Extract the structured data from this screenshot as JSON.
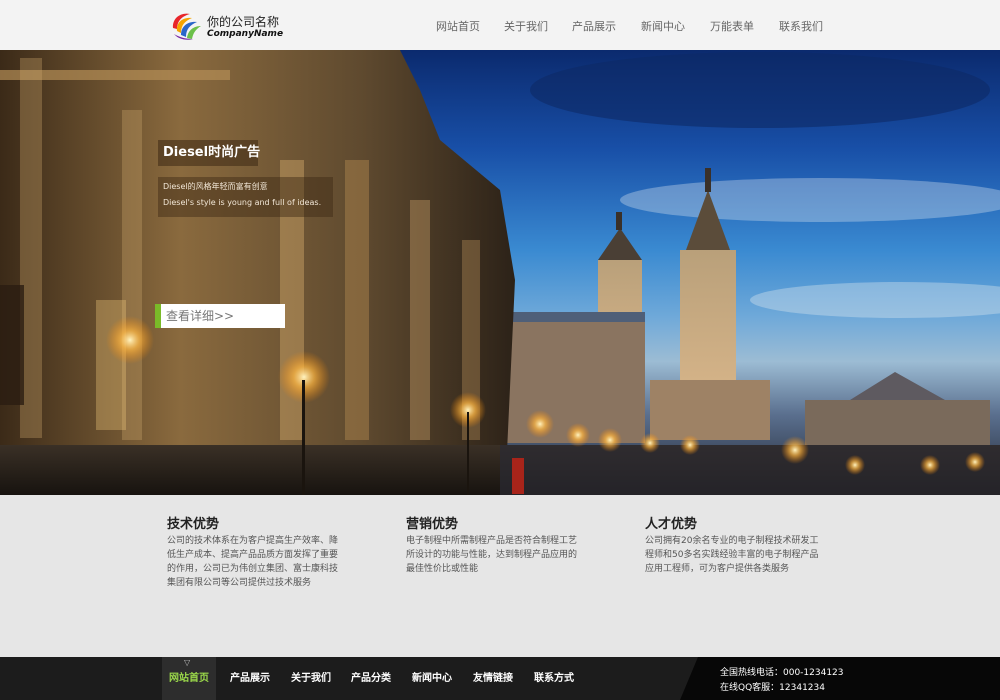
{
  "header": {
    "logo_cn": "你的公司名称",
    "logo_en": "CompanyName",
    "nav": [
      {
        "label": "网站首页"
      },
      {
        "label": "关于我们"
      },
      {
        "label": "产品展示"
      },
      {
        "label": "新闻中心"
      },
      {
        "label": "万能表单"
      },
      {
        "label": "联系我们"
      }
    ]
  },
  "banner": {
    "title": "Diesel时尚广告",
    "line1": "Diesel的风格年轻而富有创意",
    "line2": "Diesel's style is young and full of ideas.",
    "button_label": "查看详细>>",
    "accent_color": "#7aba28"
  },
  "features": [
    {
      "title": "技术优势",
      "text": "公司的技术体系在为客户提高生产效率、降低生产成本、提高产品品质方面发挥了重要的作用，公司已为伟创立集团、富士康科技集团有限公司等公司提供过技术服务"
    },
    {
      "title": "营销优势",
      "text": "电子制程中所需制程产品是否符合制程工艺所设计的功能与性能，达到制程产品应用的最佳性价比或性能"
    },
    {
      "title": "人才优势",
      "text": "公司拥有20余名专业的电子制程技术研发工程师和50多名实践经验丰富的电子制程产品应用工程师，可为客户提供各类服务"
    }
  ],
  "footer": {
    "nav": [
      {
        "label": "网站首页"
      },
      {
        "label": "产品展示"
      },
      {
        "label": "关于我们"
      },
      {
        "label": "产品分类"
      },
      {
        "label": "新闻中心"
      },
      {
        "label": "友情链接"
      },
      {
        "label": "联系方式"
      }
    ],
    "hotline": "全国热线电话：000-1234123",
    "qq": "在线QQ客服：12341234",
    "active_color": "#9ad84a"
  }
}
